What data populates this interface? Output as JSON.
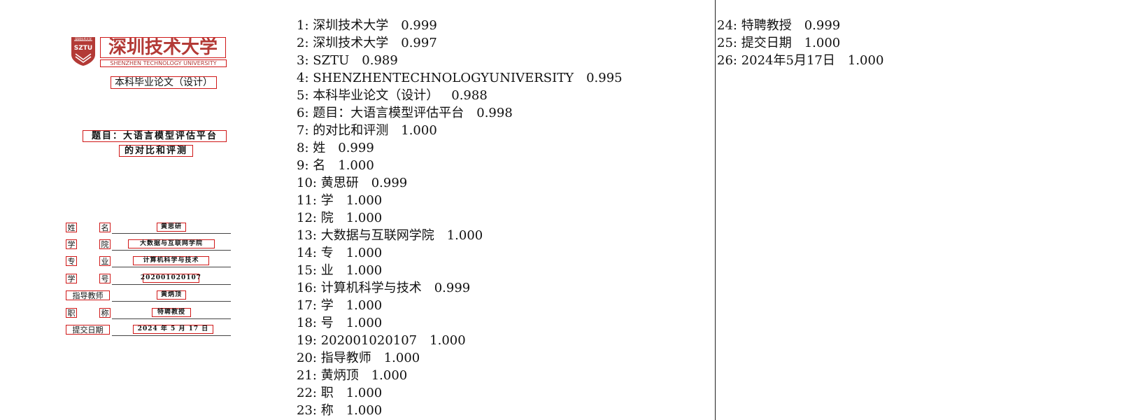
{
  "document": {
    "logo": {
      "seal_text": "SZTU",
      "seal_small_text": "深圳技术大学",
      "title": "深圳技术大学",
      "subtitle": "SHENZHEN TECHNOLOGY UNIVERSITY",
      "brand_color": "#b33a36"
    },
    "thesis_type": "本科毕业论文（设计）",
    "title_line_1": "题目：大语言模型评估平台",
    "title_line_2": "的对比和评测",
    "info": [
      {
        "label_parts": [
          "姓",
          "名"
        ],
        "value": "黄思研"
      },
      {
        "label_parts": [
          "学",
          "院"
        ],
        "value": "大数据与互联网学院"
      },
      {
        "label_parts": [
          "专",
          "业"
        ],
        "value": "计算机科学与技术"
      },
      {
        "label_parts": [
          "学",
          "号"
        ],
        "value": "202001020107"
      },
      {
        "label_parts": [
          "指导教师"
        ],
        "value": "黄炳顶"
      },
      {
        "label_parts": [
          "职",
          "称"
        ],
        "value": "特聘教授"
      },
      {
        "label_parts": [
          "提交日期"
        ],
        "value": "2024 年  5 月  17 日"
      }
    ],
    "box_color": "#d01818"
  },
  "results": {
    "column_1": [
      {
        "index": "1",
        "text": "深圳技术大学",
        "score": "0.999"
      },
      {
        "index": "2",
        "text": "深圳技术大学",
        "score": "0.997"
      },
      {
        "index": "3",
        "text": "SZTU",
        "score": "0.989"
      },
      {
        "index": "4",
        "text": "SHENZHENTECHNOLOGYUNIVERSITY",
        "score": "0.995"
      },
      {
        "index": "5",
        "text": "本科毕业论文（设计）",
        "score": "0.988"
      },
      {
        "index": "6",
        "text": "题目：大语言模型评估平台",
        "score": "0.998"
      },
      {
        "index": "7",
        "text": "的对比和评测",
        "score": "1.000"
      },
      {
        "index": "8",
        "text": "姓",
        "score": "0.999"
      },
      {
        "index": "9",
        "text": "名",
        "score": "1.000"
      },
      {
        "index": "10",
        "text": "黄思研",
        "score": "0.999"
      },
      {
        "index": "11",
        "text": "学",
        "score": "1.000"
      },
      {
        "index": "12",
        "text": "院",
        "score": "1.000"
      },
      {
        "index": "13",
        "text": "大数据与互联网学院",
        "score": "1.000"
      },
      {
        "index": "14",
        "text": "专",
        "score": "1.000"
      },
      {
        "index": "15",
        "text": "业",
        "score": "1.000"
      },
      {
        "index": "16",
        "text": "计算机科学与技术",
        "score": "0.999"
      },
      {
        "index": "17",
        "text": "学",
        "score": "1.000"
      },
      {
        "index": "18",
        "text": "号",
        "score": "1.000"
      },
      {
        "index": "19",
        "text": "202001020107",
        "score": "1.000"
      },
      {
        "index": "20",
        "text": "指导教师",
        "score": "1.000"
      },
      {
        "index": "21",
        "text": "黄炳顶",
        "score": "1.000"
      },
      {
        "index": "22",
        "text": "职",
        "score": "1.000"
      },
      {
        "index": "23",
        "text": "称",
        "score": "1.000"
      }
    ],
    "column_2": [
      {
        "index": "24",
        "text": "特聘教授",
        "score": "0.999"
      },
      {
        "index": "25",
        "text": "提交日期",
        "score": "1.000"
      },
      {
        "index": "26",
        "text": "2024年5月17日",
        "score": "1.000"
      }
    ]
  }
}
